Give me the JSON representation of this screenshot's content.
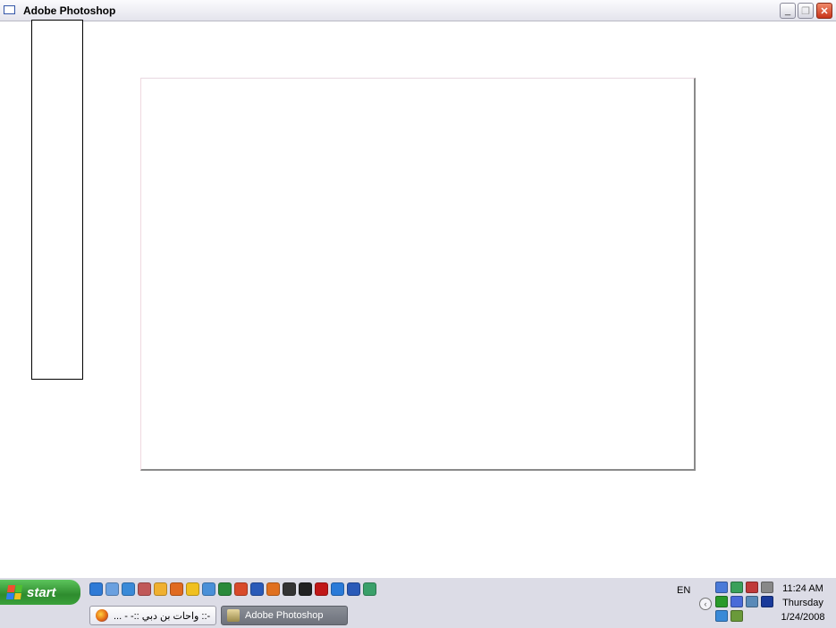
{
  "window": {
    "title": "Adobe Photoshop",
    "controls": {
      "minimize": "_",
      "restore": "❐",
      "close": "✕"
    }
  },
  "taskbar": {
    "start_label": "start",
    "quick_launch": [
      {
        "icon": "internet-explorer-icon",
        "color": "#2f7ad6"
      },
      {
        "icon": "notepad-icon",
        "color": "#6aa0e0"
      },
      {
        "icon": "outlook-express-icon",
        "color": "#3a8ad8"
      },
      {
        "icon": "ie-settings-icon",
        "color": "#c05858"
      },
      {
        "icon": "messenger-icon",
        "color": "#f0b030"
      },
      {
        "icon": "media-icon",
        "color": "#e06a20"
      },
      {
        "icon": "norton-icon",
        "color": "#f0c020"
      },
      {
        "icon": "network-icon",
        "color": "#4a90d8"
      },
      {
        "icon": "excel-icon",
        "color": "#2a8a3a"
      },
      {
        "icon": "powerpoint-icon",
        "color": "#d84a2a"
      },
      {
        "icon": "word-doc-icon",
        "color": "#2a5ab8"
      },
      {
        "icon": "firefox-icon",
        "color": "#e07020"
      },
      {
        "icon": "media-player-icon",
        "color": "#333333"
      },
      {
        "icon": "calculator-icon",
        "color": "#222222"
      },
      {
        "icon": "real-player-icon",
        "color": "#c01818"
      },
      {
        "icon": "chat-icon",
        "color": "#2a7ad8"
      },
      {
        "icon": "word-icon",
        "color": "#2a5ab8"
      },
      {
        "icon": "users-icon",
        "color": "#3aa06a"
      }
    ],
    "tasks": [
      {
        "label": "... - -:: واحات بن دبي ::-",
        "icon": "firefox-icon"
      },
      {
        "label": "Adobe Photoshop",
        "icon": "photoshop-icon"
      }
    ],
    "language": "EN",
    "tray_icons": [
      "network-icon",
      "messenger-tray-icon",
      "antivirus-icon",
      "disk-icon",
      "signal-icon",
      "computer-icon",
      "shield-icon",
      "display-icon",
      "bluetooth-icon",
      "usb-icon"
    ],
    "clock": {
      "time": "11:24 AM",
      "day": "Thursday",
      "date": "1/24/2008"
    }
  }
}
